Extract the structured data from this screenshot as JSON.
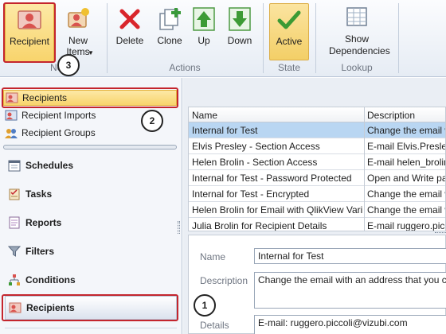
{
  "ribbon": {
    "buttons": {
      "recipient": "Recipient",
      "new_items": "New Items",
      "delete": "Delete",
      "clone": "Clone",
      "up": "Up",
      "down": "Down",
      "active": "Active",
      "show_dependencies": "Show Dependencies"
    },
    "groups": {
      "new": "New",
      "actions": "Actions",
      "state": "State",
      "lookup": "Lookup"
    }
  },
  "callouts": {
    "one": "1",
    "two": "2",
    "three": "3"
  },
  "nav": {
    "sub_items": [
      "Recipients",
      "Recipient Imports",
      "Recipient Groups"
    ],
    "main_items": [
      "Schedules",
      "Tasks",
      "Reports",
      "Filters",
      "Conditions",
      "Recipients"
    ]
  },
  "grid": {
    "columns": [
      "Name",
      "Description"
    ],
    "rows": [
      {
        "name": "Internal for Test",
        "description": "Change the email with an address that you can"
      },
      {
        "name": "Elvis Presley - Section Access",
        "description": "E-mail Elvis.Presley@qlikview.com"
      },
      {
        "name": "Helen Brolin - Section Access",
        "description": "E-mail helen_brolin@hotmail.com"
      },
      {
        "name": "Internal for Test - Password Protected",
        "description": "Open and Write password"
      },
      {
        "name": "Internal for Test - Encrypted",
        "description": "Change the email with an address"
      },
      {
        "name": "Helen Brolin for Email with QlikView Variable",
        "description": "Change the email with an address"
      },
      {
        "name": "Julia Brolin for Recipient Details",
        "description": "E-mail ruggero.piccoli@vizubi.com"
      }
    ]
  },
  "details": {
    "name_label": "Name",
    "name_value": "Internal for Test",
    "description_label": "Description",
    "description_value": "Change the email with an address that you can",
    "details_label": "Details",
    "details_value": "E-mail: ruggero.piccoli@vizubi.com"
  },
  "colors": {
    "highlight": "#c4252d",
    "selected_row": "#b9d6f2",
    "active_button": "#f7d77a"
  }
}
